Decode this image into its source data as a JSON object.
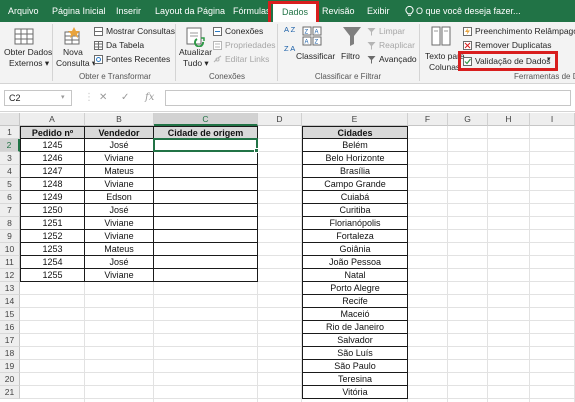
{
  "tabs": [
    {
      "label": "Arquivo"
    },
    {
      "label": "Página Inicial"
    },
    {
      "label": "Inserir"
    },
    {
      "label": "Layout da Página"
    },
    {
      "label": "Fórmulas"
    },
    {
      "label": "Dados"
    },
    {
      "label": "Revisão"
    },
    {
      "label": "Exibir"
    }
  ],
  "tell_me": "O que você deseja fazer...",
  "ribbon": {
    "obter_dados_line1": "Obter Dados",
    "obter_dados_line2": "Externos",
    "nova_consulta_line1": "Nova",
    "nova_consulta_line2": "Consulta",
    "mostrar_consultas": "Mostrar Consultas",
    "da_tabela": "Da Tabela",
    "fontes_recentes": "Fontes Recentes",
    "group_obter": "Obter e Transformar",
    "atualizar_line1": "Atualizar",
    "atualizar_line2": "Tudo",
    "conexoes": "Conexões",
    "propriedades": "Propriedades",
    "editar_links": "Editar Links",
    "group_conexoes": "Conexões",
    "az": "A Z",
    "za": "Z A",
    "classificar": "Classificar",
    "filtro": "Filtro",
    "limpar": "Limpar",
    "reaplicar": "Reaplicar",
    "avancado": "Avançado",
    "group_classificar": "Classificar e Filtrar",
    "texto_colunas_line1": "Texto para",
    "texto_colunas_line2": "Colunas",
    "preenchimento": "Preenchimento Relâmpago",
    "remover_duplicatas": "Remover Duplicatas",
    "validacao": "Validação de Dados",
    "group_ferramentas": "Ferramentas de D"
  },
  "formula_bar": {
    "name_box": "C2",
    "cancel": "✕",
    "enter": "✓",
    "fx": "fx",
    "content": ""
  },
  "columns": [
    "A",
    "B",
    "C",
    "D",
    "E",
    "F",
    "G",
    "H",
    "I"
  ],
  "selected_cell": "C2",
  "table": {
    "headers": [
      "Pedido nº",
      "Vendedor",
      "Cidade de origem"
    ],
    "rows": [
      [
        "1245",
        "José",
        ""
      ],
      [
        "1246",
        "Viviane",
        ""
      ],
      [
        "1247",
        "Mateus",
        ""
      ],
      [
        "1248",
        "Viviane",
        ""
      ],
      [
        "1249",
        "Edson",
        ""
      ],
      [
        "1250",
        "José",
        ""
      ],
      [
        "1251",
        "Viviane",
        ""
      ],
      [
        "1252",
        "Viviane",
        ""
      ],
      [
        "1253",
        "Mateus",
        ""
      ],
      [
        "1254",
        "José",
        ""
      ],
      [
        "1255",
        "Viviane",
        ""
      ]
    ]
  },
  "cities": {
    "header": "Cidades",
    "items": [
      "Belém",
      "Belo Horizonte",
      "Brasília",
      "Campo Grande",
      "Cuiabá",
      "Curitiba",
      "Florianópolis",
      "Fortaleza",
      "Goiânia",
      "João Pessoa",
      "Natal",
      "Porto Alegre",
      "Recife",
      "Maceió",
      "Rio de Janeiro",
      "Salvador",
      "São Luís",
      "São Paulo",
      "Teresina",
      "Vitória"
    ]
  },
  "colors": {
    "excel_green": "#217346",
    "highlight_red": "#d81e1e",
    "header_fill": "#d9d9d9"
  }
}
